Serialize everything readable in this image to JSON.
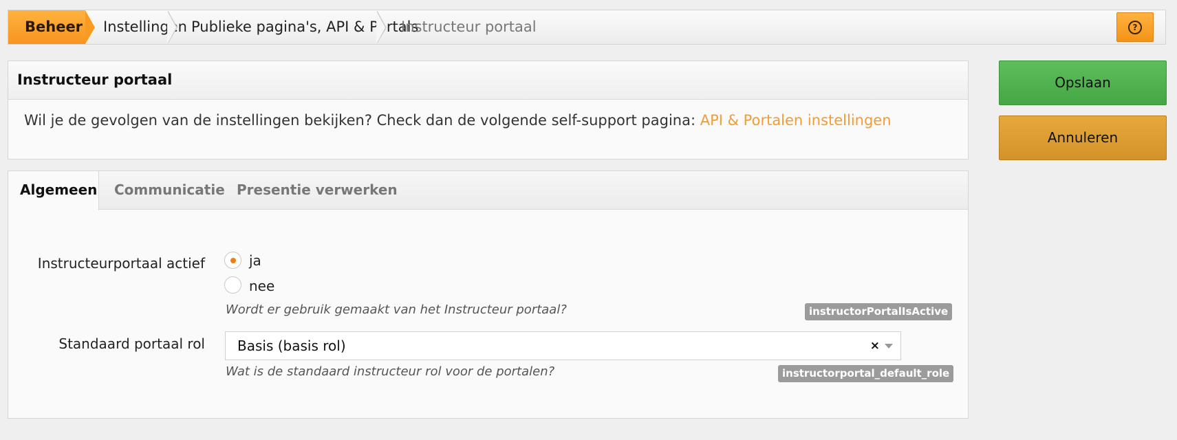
{
  "breadcrumb": {
    "items": [
      "Beheer",
      "Instellingen",
      "Publieke pagina's, API & Portals",
      "Instructeur portaal"
    ],
    "help_icon": "question-circle-icon"
  },
  "info_panel": {
    "title": "Instructeur portaal",
    "text": "Wil je de gevolgen van de instellingen bekijken? Check dan de volgende self-support pagina: ",
    "link_text": "API & Portalen instellingen"
  },
  "tabs": [
    "Algemeen",
    "Communicatie",
    "Presentie verwerken"
  ],
  "fields": {
    "active": {
      "label": "Instructeurportaal actief",
      "options": [
        "ja",
        "nee"
      ],
      "selected": "ja",
      "hint": "Wordt er gebruik gemaakt van het Instructeur portaal?",
      "tag": "instructorPortalIsActive"
    },
    "role": {
      "label": "Standaard portaal rol",
      "value": "Basis (basis rol)",
      "clear": "×",
      "hint": "Wat is de standaard instructeur rol voor de portalen?",
      "tag": "instructorportal_default_role"
    }
  },
  "buttons": {
    "save": "Opslaan",
    "cancel": "Annuleren"
  },
  "colors": {
    "accent": "#f7951f",
    "save": "#4cae4c",
    "cancel": "#d9982e",
    "link": "#f39c34"
  }
}
